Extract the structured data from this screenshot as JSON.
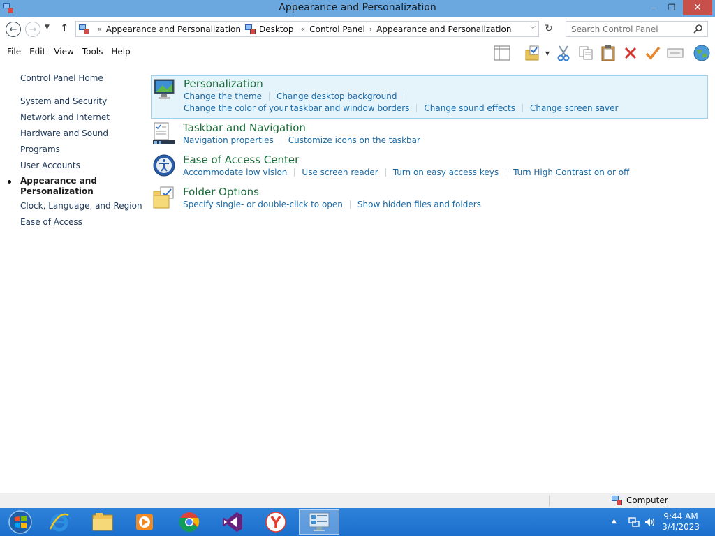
{
  "window": {
    "title": "Appearance and Personalization",
    "controls": {
      "minimize": "–",
      "maximize": "❐",
      "close": "✕"
    }
  },
  "address": {
    "prefix": "«",
    "crumbs": [
      "Appearance and Personalization",
      "Desktop",
      "Control Panel",
      "Appearance and Personalization"
    ],
    "separators": [
      "«",
      "›"
    ],
    "search_placeholder": "Search Control Panel"
  },
  "menu": [
    "File",
    "Edit",
    "View",
    "Tools",
    "Help"
  ],
  "toolbar_icons": [
    "layout-pane-icon",
    "folder-check-icon",
    "dropdown-arrow-icon",
    "cut-icon",
    "copy-icon",
    "paste-icon",
    "delete-icon",
    "checkmark-icon",
    "properties-icon",
    "globe-icon"
  ],
  "sidebar": {
    "home": "Control Panel Home",
    "items": [
      {
        "label": "System and Security",
        "active": false
      },
      {
        "label": "Network and Internet",
        "active": false
      },
      {
        "label": "Hardware and Sound",
        "active": false
      },
      {
        "label": "Programs",
        "active": false
      },
      {
        "label": "User Accounts",
        "active": false
      },
      {
        "label": "Appearance and Personalization",
        "line1": "Appearance and",
        "line2": "Personalization",
        "active": true
      },
      {
        "label": "Clock, Language, and Region",
        "active": false
      },
      {
        "label": "Ease of Access",
        "active": false
      }
    ]
  },
  "categories": [
    {
      "title": "Personalization",
      "icon": "personalization-icon",
      "links_row1": [
        "Change the theme",
        "Change desktop background"
      ],
      "links_row2": [
        "Change the color of your taskbar and window borders",
        "Change sound effects",
        "Change screen saver"
      ]
    },
    {
      "title": "Taskbar and Navigation",
      "icon": "taskbar-icon",
      "links_row1": [
        "Navigation properties",
        "Customize icons on the taskbar"
      ]
    },
    {
      "title": "Ease of Access Center",
      "icon": "ease-of-access-icon",
      "links_row1": [
        "Accommodate low vision",
        "Use screen reader",
        "Turn on easy access keys",
        "Turn High Contrast on or off"
      ]
    },
    {
      "title": "Folder Options",
      "icon": "folder-options-icon",
      "links_row1": [
        "Specify single- or double-click to open",
        "Show hidden files and folders"
      ]
    }
  ],
  "statusbar": {
    "location": "Computer"
  },
  "taskbar": {
    "apps": [
      "start-orb",
      "internet-explorer",
      "file-explorer",
      "media-player",
      "chrome",
      "visual-studio",
      "yandex-browser",
      "control-panel"
    ],
    "clock": {
      "time": "9:44 AM",
      "date": "3/4/2023"
    }
  },
  "colors": {
    "titlebar": "#6ca8e0",
    "category_title": "#1c6b3a",
    "link": "#1a6aa6",
    "sidebar_link": "#1e395b",
    "hover_bg": "#e5f3fb",
    "close_button": "#c7504a",
    "taskbar": "#1b6fcc"
  }
}
